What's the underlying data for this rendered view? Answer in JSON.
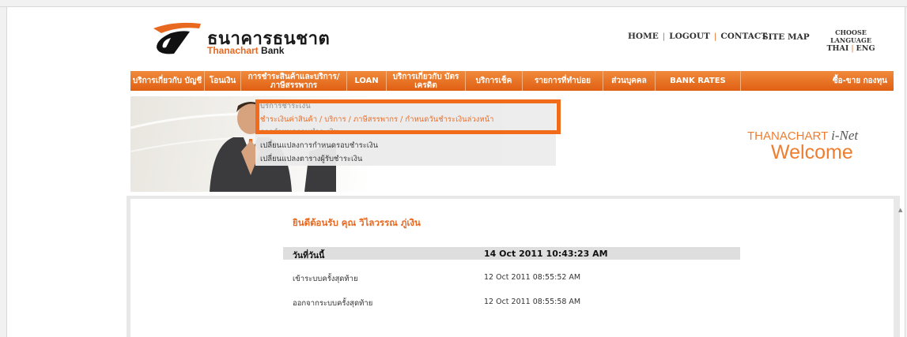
{
  "header": {
    "bank_name_th": "ธนาคารธนชาต",
    "bank_name_en_a": "Thanachart",
    "bank_name_en_b": "Bank",
    "links": [
      "HOME",
      "LOGOUT",
      "CONTACT"
    ],
    "site_map": "SITE MAP",
    "choose_language": "CHOOSE LANGUAGE",
    "lang_thai": "THAI",
    "lang_eng": "ENG"
  },
  "nav": {
    "items": [
      {
        "label": "บริการเกี่ยวกับ บัญชี"
      },
      {
        "label": "โอนเงิน"
      },
      {
        "label": "การชำระสินค้าและบริการ/ ภาษีสรรพากร"
      },
      {
        "label": "LOAN"
      },
      {
        "label": "บริการเกี่ยวกับ บัตรเครดิต"
      },
      {
        "label": "บริการเช็ค"
      },
      {
        "label": "รายการที่ทำบ่อย"
      },
      {
        "label": "ส่วนบุคคล"
      },
      {
        "label": "BANK RATES"
      },
      {
        "label": "ซื้อ-ขาย กองทุน"
      }
    ]
  },
  "submenu": {
    "items": [
      "บริการชำระเงิน",
      "ชำระเงินค่าสินค้า / บริการ / ภาษีสรรพากร / กำหนดวันชำระเงินล่วงหน้า",
      "การกำหนดรอบชำระเงิน",
      "เปลี่ยนแปลงการกำหนดรอบชำระเงิน",
      "เปลี่ยนแปลงตารางผู้รับชำระเงิน"
    ]
  },
  "welcome": {
    "brand": "THANACHART",
    "brand_suffix": "i-Net",
    "text": "Welcome"
  },
  "content": {
    "greeting": "ยินดีต้อนรับ คุณ วิไลวรรณ ภู่เงิน",
    "rows": [
      {
        "label": "วันที่วันนี้",
        "value": "14 Oct 2011 10:43:23 AM"
      },
      {
        "label": "เข้าระบบครั้งสุดท้าย",
        "value": "12 Oct 2011 08:55:52 AM"
      },
      {
        "label": "ออกจากระบบครั้งสุดท้าย",
        "value": "12 Oct 2011 08:55:58 AM"
      }
    ]
  },
  "colors": {
    "accent": "#e8681f",
    "nav_bg": "#ef7a2a"
  }
}
